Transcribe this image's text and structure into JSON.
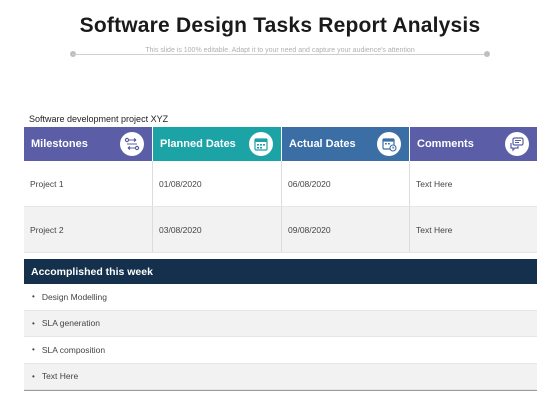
{
  "title": "Software Design Tasks Report Analysis",
  "subtitle": "This slide is 100% editable. Adapt it to your need and capture your audience's attention",
  "project_label": "Software development project XYZ",
  "table": {
    "headers": [
      {
        "label": "Milestones",
        "icon": "workflow-icon"
      },
      {
        "label": "Planned Dates",
        "icon": "calendar-icon"
      },
      {
        "label": "Actual Dates",
        "icon": "calendar-check-icon"
      },
      {
        "label": "Comments",
        "icon": "chat-bubbles-icon"
      }
    ],
    "rows": [
      {
        "milestone": "Project 1",
        "planned": "01/08/2020",
        "actual": "06/08/2020",
        "comment": "Text Here"
      },
      {
        "milestone": "Project 2",
        "planned": "03/08/2020",
        "actual": "09/08/2020",
        "comment": "Text Here"
      }
    ]
  },
  "week": {
    "heading": "Accomplished this week",
    "items": [
      "Design Modelling",
      "SLA generation",
      "SLA composition",
      "Text Here"
    ]
  },
  "colors": {
    "milestones_header": "#5b5ea6",
    "planned_header": "#1ba3a6",
    "actual_header": "#3a6ea5",
    "comments_header": "#5b5ea6",
    "week_bar": "#14304d"
  }
}
